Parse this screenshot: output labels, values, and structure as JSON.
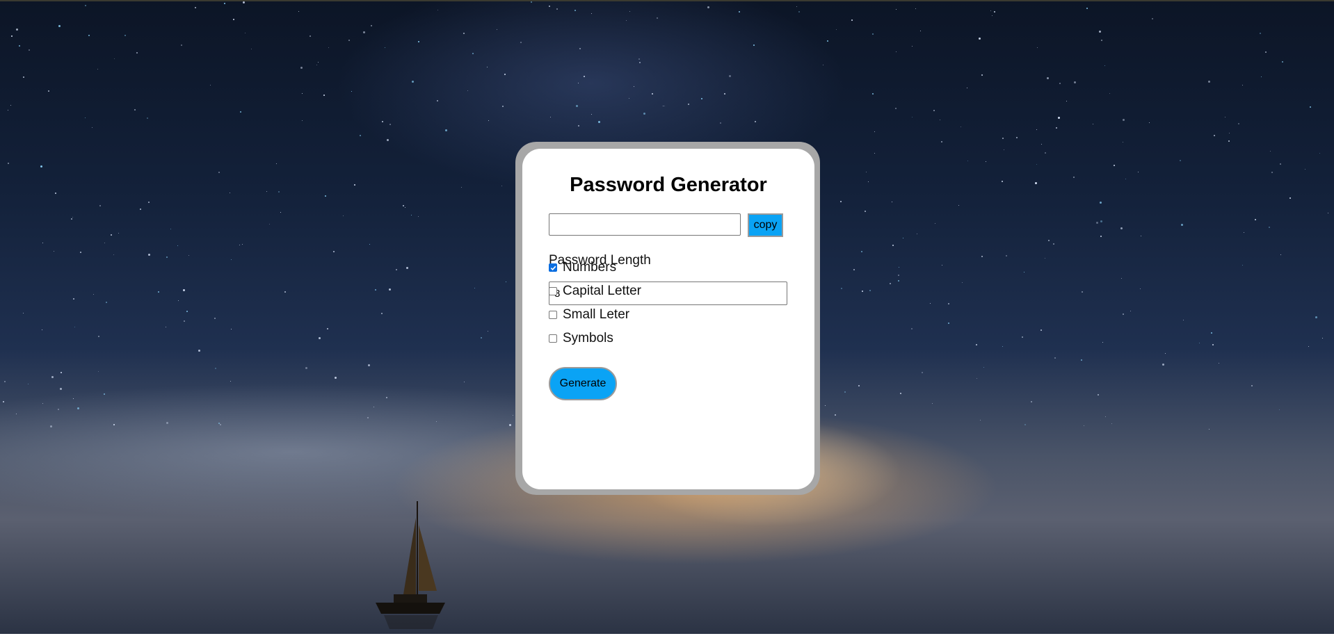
{
  "app": {
    "title": "Password Generator"
  },
  "password_field": {
    "value": "",
    "copy_label": "copy"
  },
  "length": {
    "label": "Password Length",
    "value": "8"
  },
  "options": [
    {
      "label": "Numbers",
      "checked": true
    },
    {
      "label": "Capital Letter",
      "checked": false
    },
    {
      "label": "Small Leter",
      "checked": false
    },
    {
      "label": "Symbols",
      "checked": false
    }
  ],
  "generate_label": "Generate",
  "colors": {
    "accent": "#0aa3f5",
    "card_border": "#a7a7a7",
    "checkbox_checked": "#0b6ee0"
  },
  "background_icon": "sailboat-night-sky"
}
